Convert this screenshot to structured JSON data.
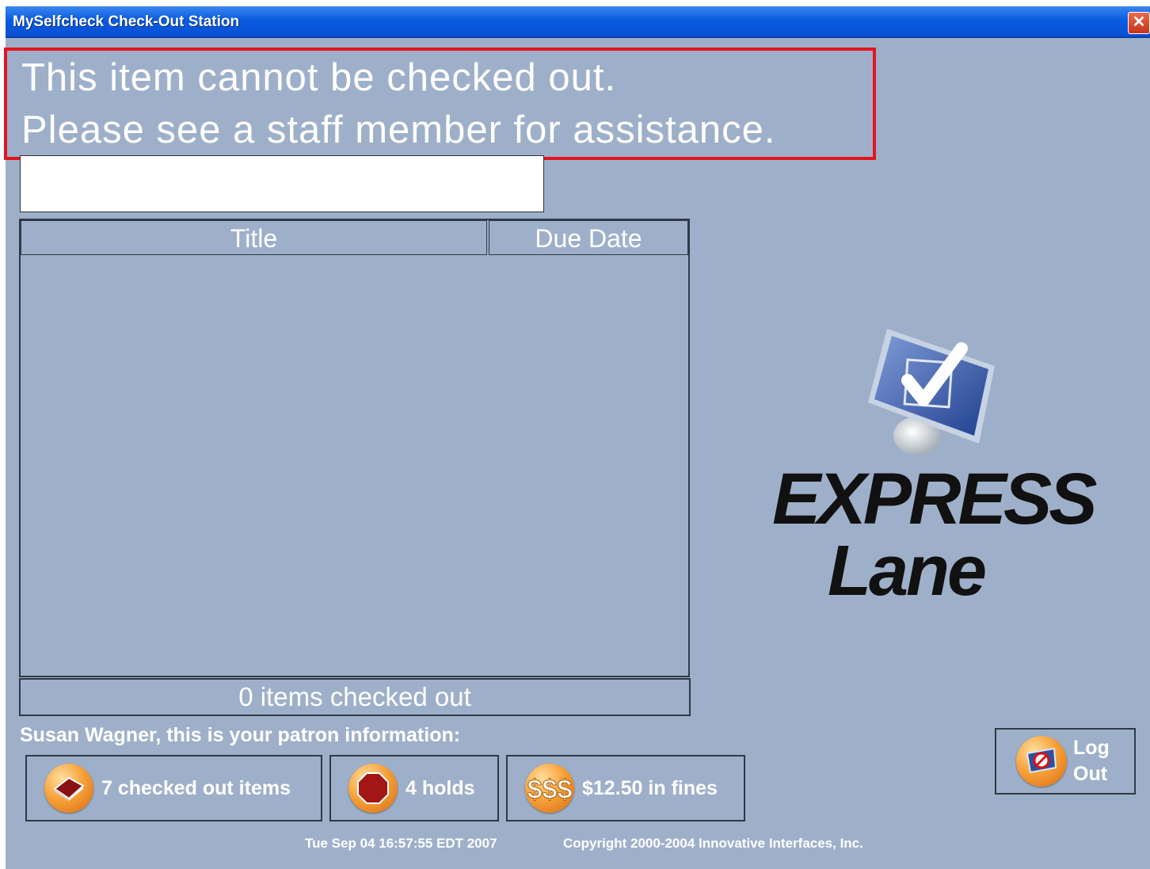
{
  "window": {
    "title": "MySelfcheck Check-Out Station",
    "close_label": "✕"
  },
  "message": {
    "line1": "This item cannot be checked out.",
    "line2": "Please see a staff member for assistance."
  },
  "barcode_input": {
    "value": ""
  },
  "table": {
    "columns": [
      "Title",
      "Due Date"
    ],
    "rows": []
  },
  "summary": {
    "count_text": "0 items checked out"
  },
  "patron": {
    "label": "Susan Wagner, this is your patron information:",
    "buttons": {
      "checked_out": "7 checked out items",
      "holds": "4 holds",
      "fines": "$12.50 in fines"
    },
    "logout": {
      "line1": "Log",
      "line2": "Out"
    }
  },
  "logo": {
    "line1": "EXPRESS",
    "line2": "Lane"
  },
  "footer": {
    "datetime": "Tue Sep 04 16:57:55 EDT 2007",
    "copyright": "Copyright 2000-2004 Innovative Interfaces, Inc."
  },
  "colors": {
    "background": "#9eb0c9",
    "titlebar": "#0a5ce0",
    "error_border": "#e4141e",
    "button_orb": "#f7a23b"
  },
  "icons": {
    "checked_out": "book-icon",
    "holds": "stop-sign-icon",
    "fines": "dollar-icon",
    "logout": "no-entry-monitor-icon",
    "logo": "monitor-checkmark-icon"
  }
}
